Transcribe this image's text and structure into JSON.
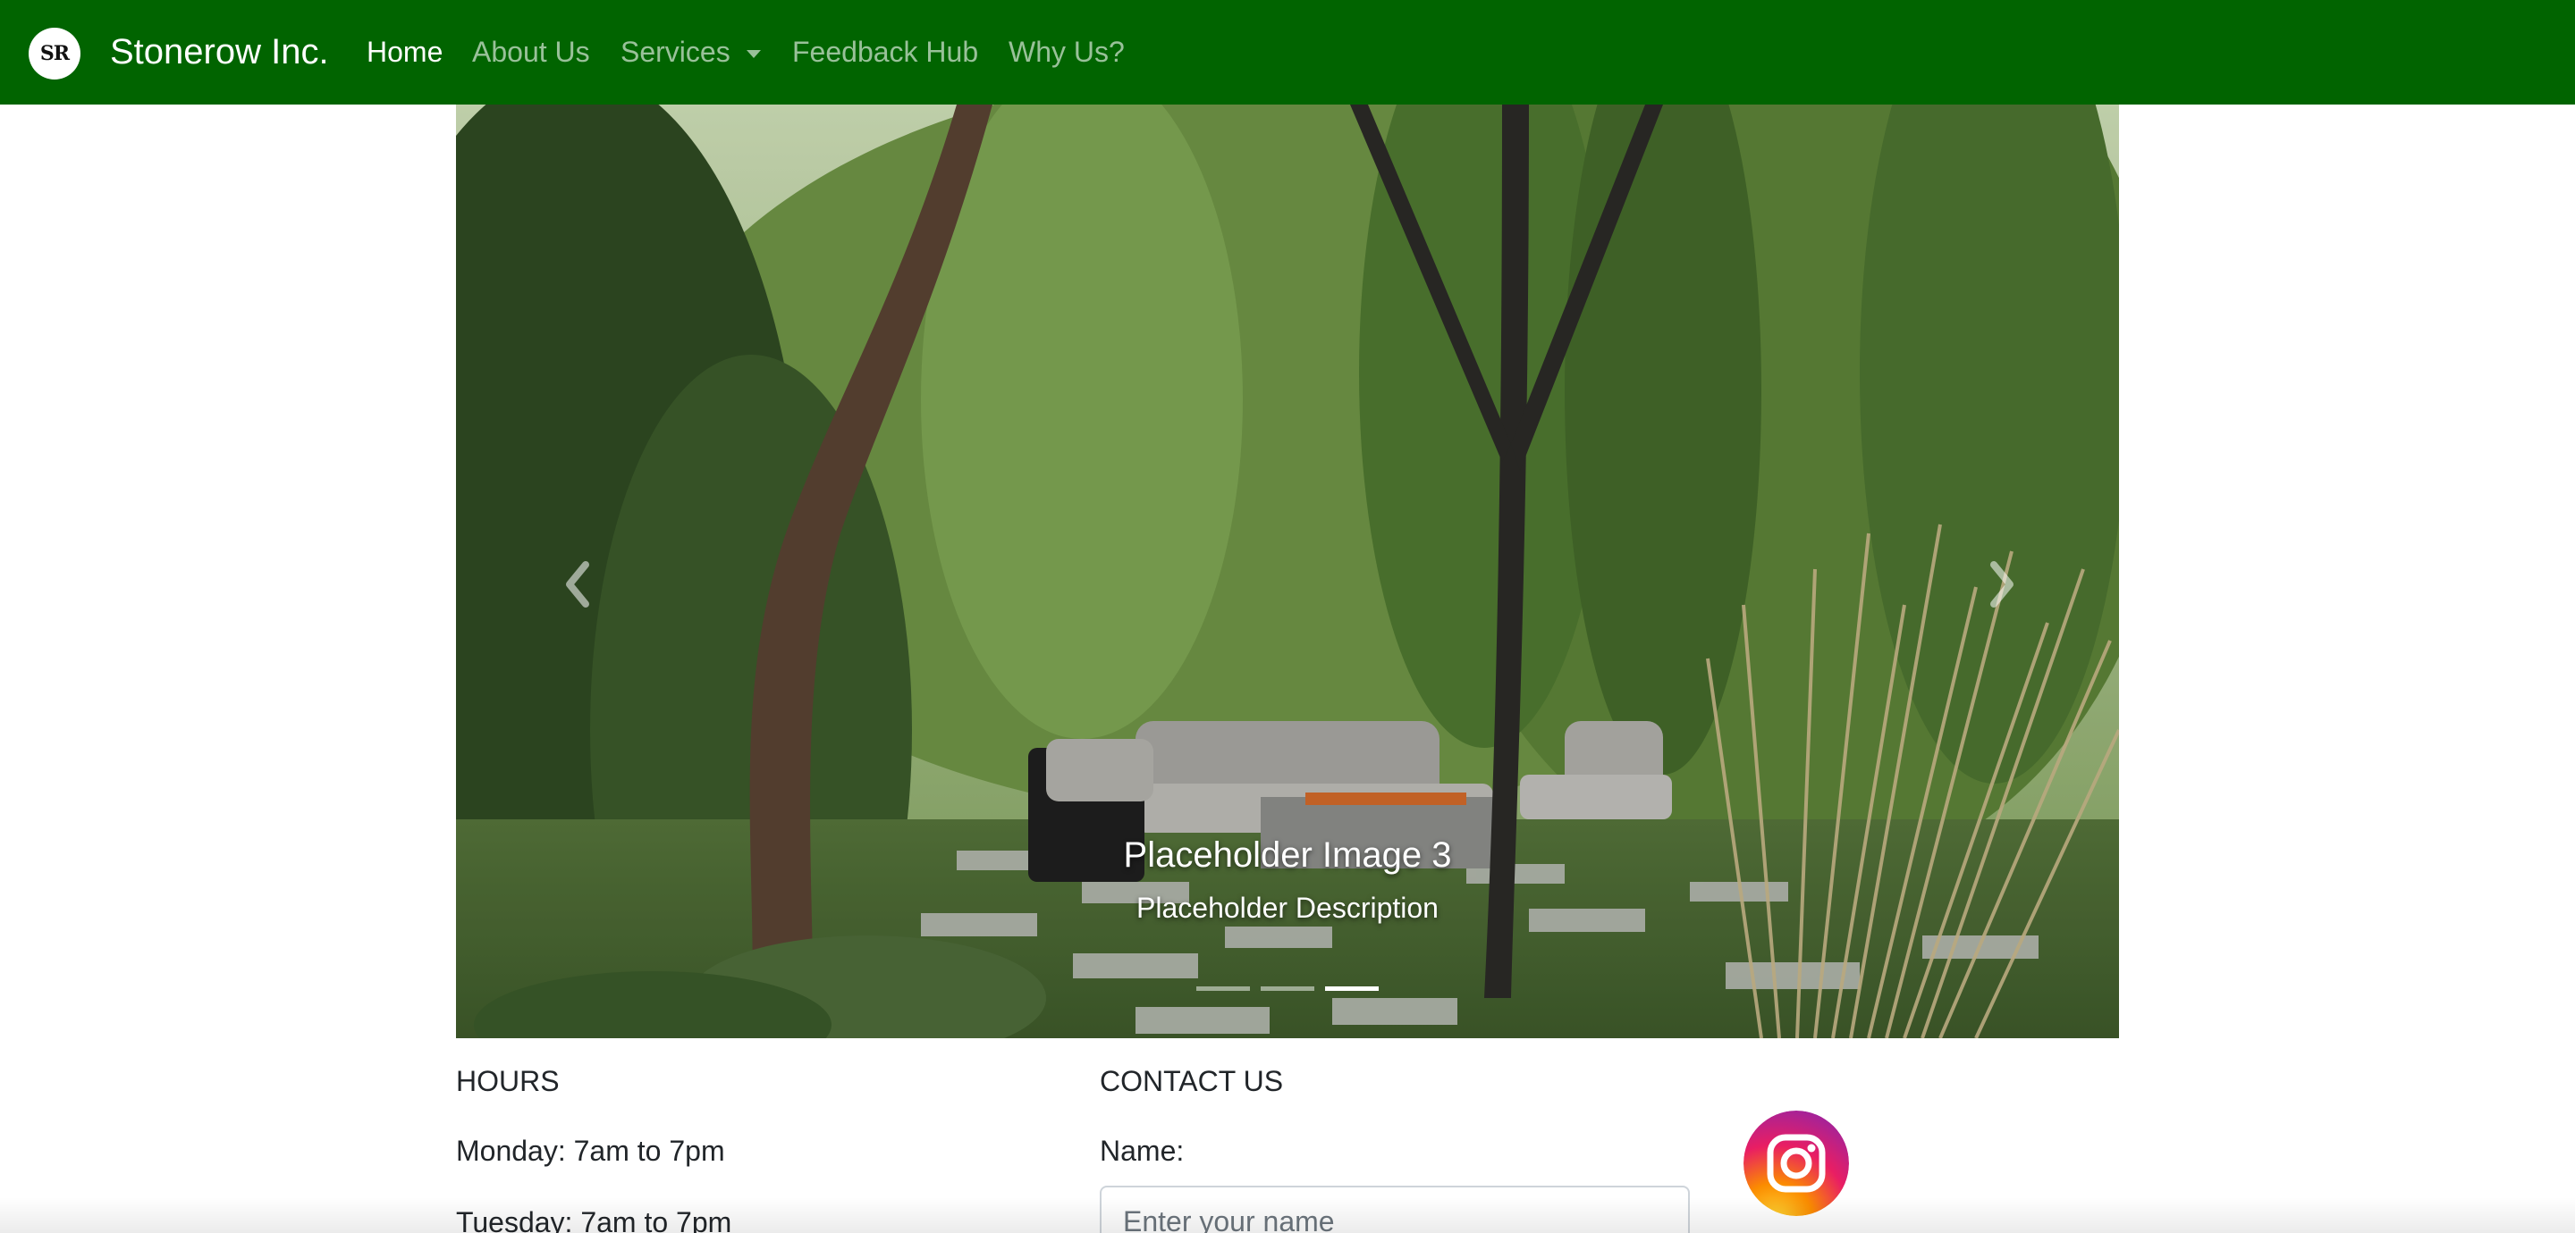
{
  "navbar": {
    "logo_text": "SR",
    "brand": "Stonerow Inc.",
    "links": [
      {
        "label": "Home",
        "active": true
      },
      {
        "label": "About Us",
        "active": false
      },
      {
        "label": "Services",
        "active": false,
        "dropdown": true
      },
      {
        "label": "Feedback Hub",
        "active": false
      },
      {
        "label": "Why Us?",
        "active": false
      }
    ],
    "background_color": "#016400"
  },
  "carousel": {
    "caption_title": "Placeholder Image 3",
    "caption_description": "Placeholder Description",
    "slide_count": 3,
    "active_index": 2,
    "prev_icon": "chevron-left-icon",
    "next_icon": "chevron-right-icon"
  },
  "hours": {
    "heading": "HOURS",
    "lines": [
      "Monday: 7am to 7pm",
      "Tuesday: 7am to 7pm"
    ]
  },
  "contact": {
    "heading": "CONTACT US",
    "name_label": "Name:",
    "name_placeholder": "Enter your name",
    "name_value": ""
  },
  "social": {
    "instagram_icon": "instagram-icon"
  }
}
